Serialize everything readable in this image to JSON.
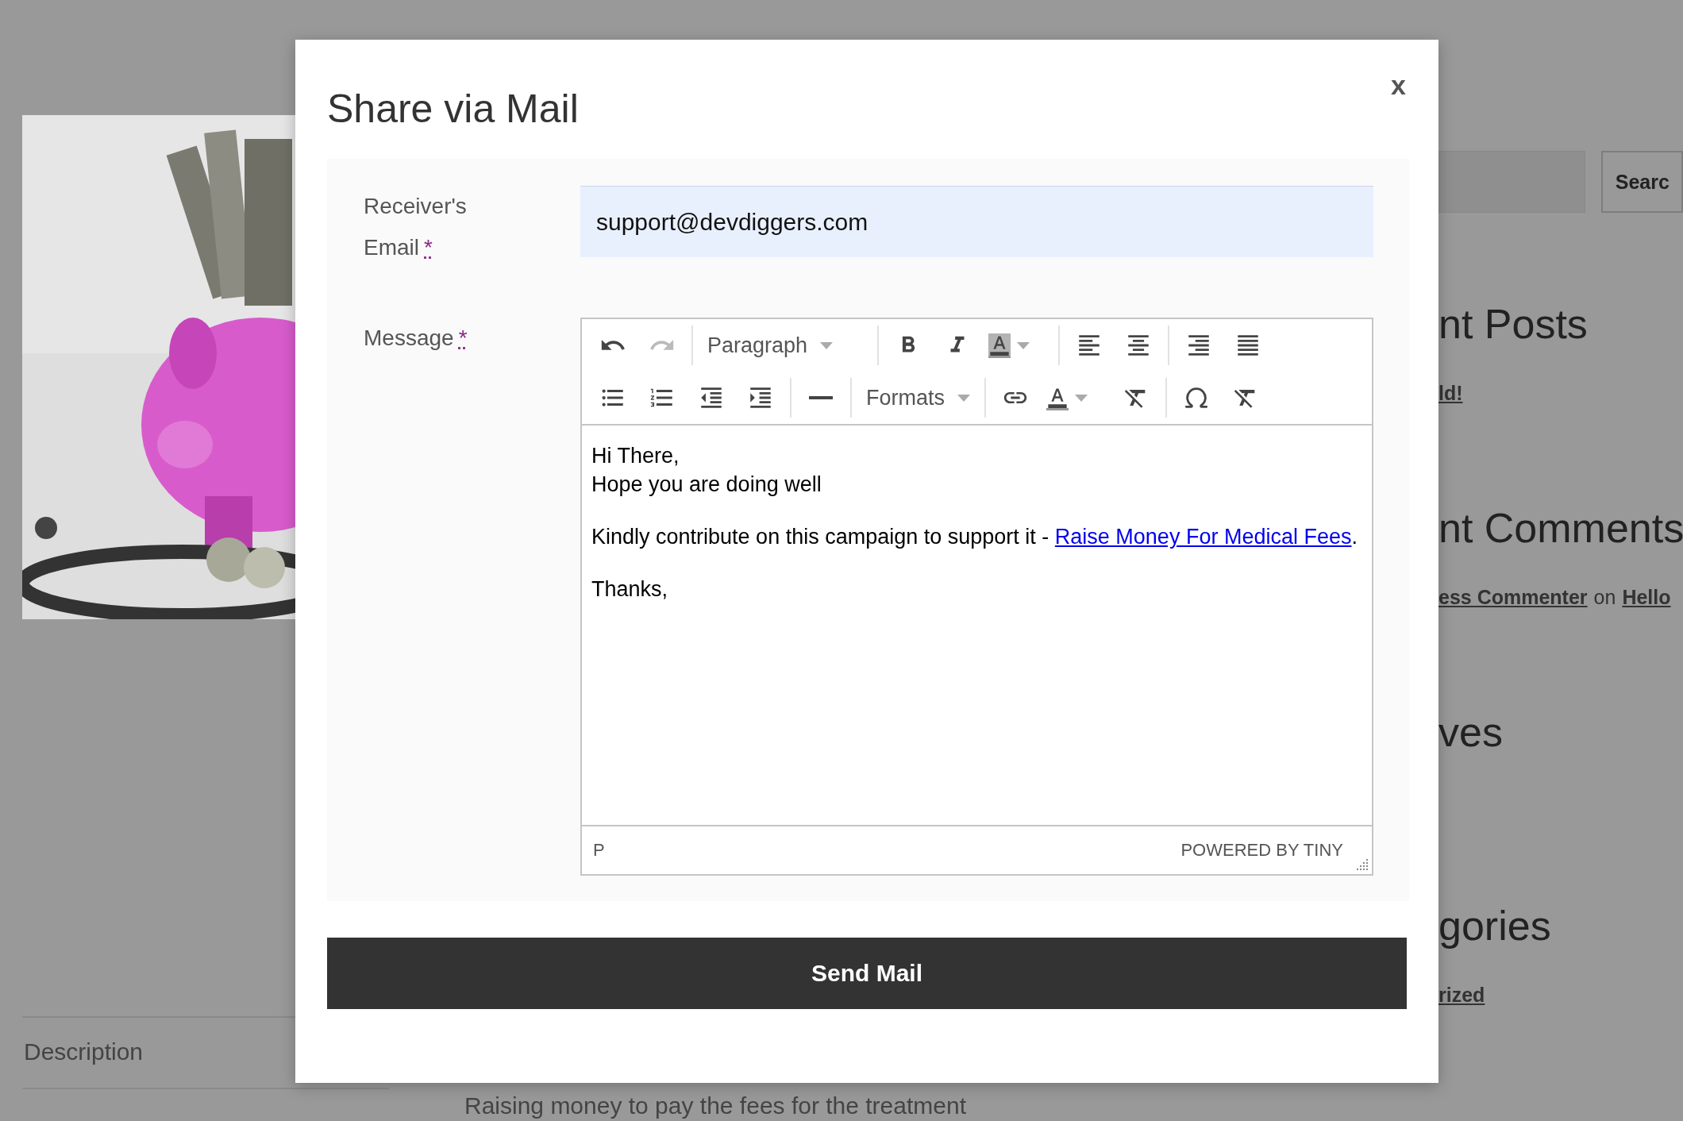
{
  "page": {
    "search_button": "Searc",
    "sidebar": [
      {
        "kind": "heading",
        "text": "nt Posts"
      },
      {
        "kind": "links",
        "parts": [
          {
            "text": "ld!",
            "link": true
          }
        ]
      },
      {
        "kind": "heading",
        "text": "nt Comments"
      },
      {
        "kind": "links",
        "parts": [
          {
            "text": "ess Commenter",
            "link": true
          },
          {
            "text": "on",
            "link": false
          },
          {
            "text": "Hello",
            "link": true
          }
        ]
      },
      {
        "kind": "heading",
        "text": "ves"
      },
      {
        "kind": "heading",
        "text": "gories"
      },
      {
        "kind": "links",
        "parts": [
          {
            "text": "rized",
            "link": true
          }
        ]
      }
    ],
    "tab": "Description",
    "body_text": "Raising money to pay the fees for the treatment"
  },
  "modal": {
    "title": "Share via Mail",
    "close": "x",
    "email": {
      "label": "Receiver's Email",
      "required_mark": "*",
      "value": "support@devdiggers.com"
    },
    "message": {
      "label": "Message",
      "required_mark": "*",
      "toolbar": [
        [
          [
            {
              "kind": "button",
              "disabled": false
            },
            {
              "kind": "button",
              "disabled": true
            }
          ],
          [
            {
              "kind": "dropdown",
              "label": "Paragraph",
              "disabled": false
            }
          ],
          [
            {
              "kind": "button",
              "disabled": false
            },
            {
              "kind": "button",
              "disabled": false
            },
            {
              "kind": "split",
              "disabled": false
            }
          ],
          [
            {
              "kind": "button",
              "disabled": false
            },
            {
              "kind": "button",
              "disabled": false
            }
          ],
          [
            {
              "kind": "button",
              "disabled": false
            },
            {
              "kind": "button",
              "disabled": false
            }
          ]
        ],
        [
          [
            {
              "kind": "button",
              "disabled": false
            },
            {
              "kind": "button",
              "disabled": false
            },
            {
              "kind": "button",
              "disabled": false
            },
            {
              "kind": "button",
              "disabled": false
            }
          ],
          [
            {
              "kind": "button",
              "disabled": false
            }
          ],
          [
            {
              "kind": "dropdown",
              "label": "Formats",
              "disabled": false
            }
          ],
          [
            {
              "kind": "button",
              "disabled": false
            },
            {
              "kind": "split",
              "disabled": false
            },
            {
              "kind": "button",
              "disabled": false
            }
          ],
          [
            {
              "kind": "button",
              "disabled": false
            },
            {
              "kind": "button",
              "disabled": false
            }
          ]
        ]
      ],
      "content": [
        {
          "kind": "lines",
          "lines": [
            "Hi There,",
            "Hope you are doing well"
          ]
        },
        {
          "kind": "linked",
          "text": "Kindly contribute on this campaign to support it - ",
          "link": "Raise Money For Medical Fees",
          "after": "."
        },
        {
          "kind": "lines",
          "lines": [
            "Thanks,"
          ]
        }
      ],
      "path": "P",
      "branding": "POWERED BY TINY"
    },
    "submit": "Send Mail"
  }
}
